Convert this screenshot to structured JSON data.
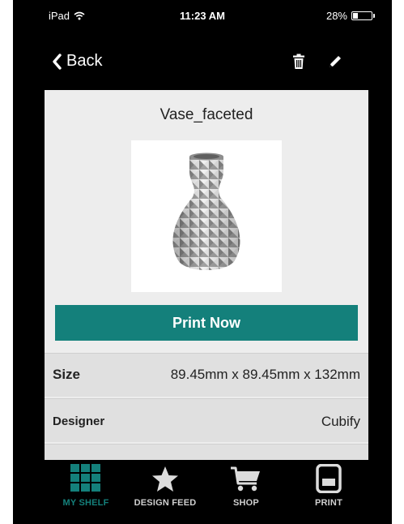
{
  "status_bar": {
    "carrier": "iPad",
    "time": "11:23 AM",
    "battery_text": "28%",
    "battery_level": 0.28
  },
  "nav": {
    "back_label": "Back",
    "back_icon": "chevron-left-icon",
    "delete_icon": "trash-icon",
    "edit_icon": "pencil-icon"
  },
  "item": {
    "title": "Vase_faceted",
    "image": "faceted-vase-3d-model",
    "print_button_label": "Print Now"
  },
  "details": {
    "size": {
      "label": "Size",
      "value": "89.45mm x 89.45mm x 132mm"
    },
    "designer": {
      "label": "Designer",
      "value": "Cubify"
    }
  },
  "tabs": [
    {
      "label": "MY SHELF",
      "icon": "grid-icon",
      "active": true
    },
    {
      "label": "DESIGN FEED",
      "icon": "star-icon",
      "active": false
    },
    {
      "label": "SHOP",
      "icon": "cart-icon",
      "active": false
    },
    {
      "label": "PRINT",
      "icon": "printer-icon",
      "active": false
    }
  ],
  "colors": {
    "accent": "#14807b",
    "background": "#000000",
    "card": "#ededed",
    "tab_inactive": "#cfcfcf"
  }
}
